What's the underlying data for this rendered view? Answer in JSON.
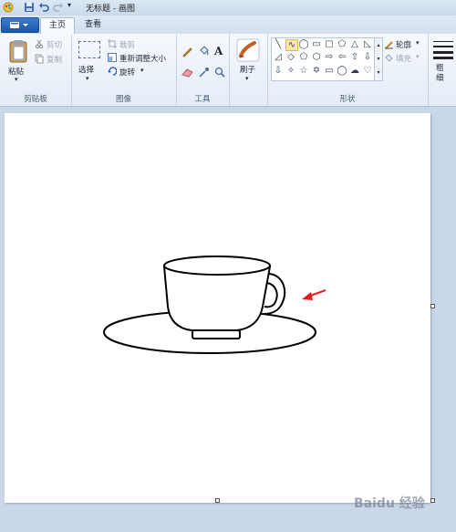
{
  "window": {
    "title": "无标题 - 画图"
  },
  "tabs": [
    {
      "label": "主页"
    },
    {
      "label": "查看"
    }
  ],
  "clipboard": {
    "paste": "粘贴",
    "cut": "剪切",
    "copy": "复制",
    "label": "剪贴板"
  },
  "image": {
    "select": "选择",
    "crop": "裁剪",
    "resize": "重新调整大小",
    "rotate": "旋转",
    "label": "图像"
  },
  "tools": {
    "label": "工具"
  },
  "brushes": {
    "label": "刷子"
  },
  "shapes": {
    "outline": "轮廓",
    "fill": "填充",
    "label": "形状"
  },
  "size": {
    "label": "粗细"
  },
  "watermark": "Baidu 经验",
  "colors": {
    "accent": "#1d58a8",
    "arrow": "#e02020",
    "canvas": "#ffffff",
    "workspace": "#c9d7e9"
  }
}
